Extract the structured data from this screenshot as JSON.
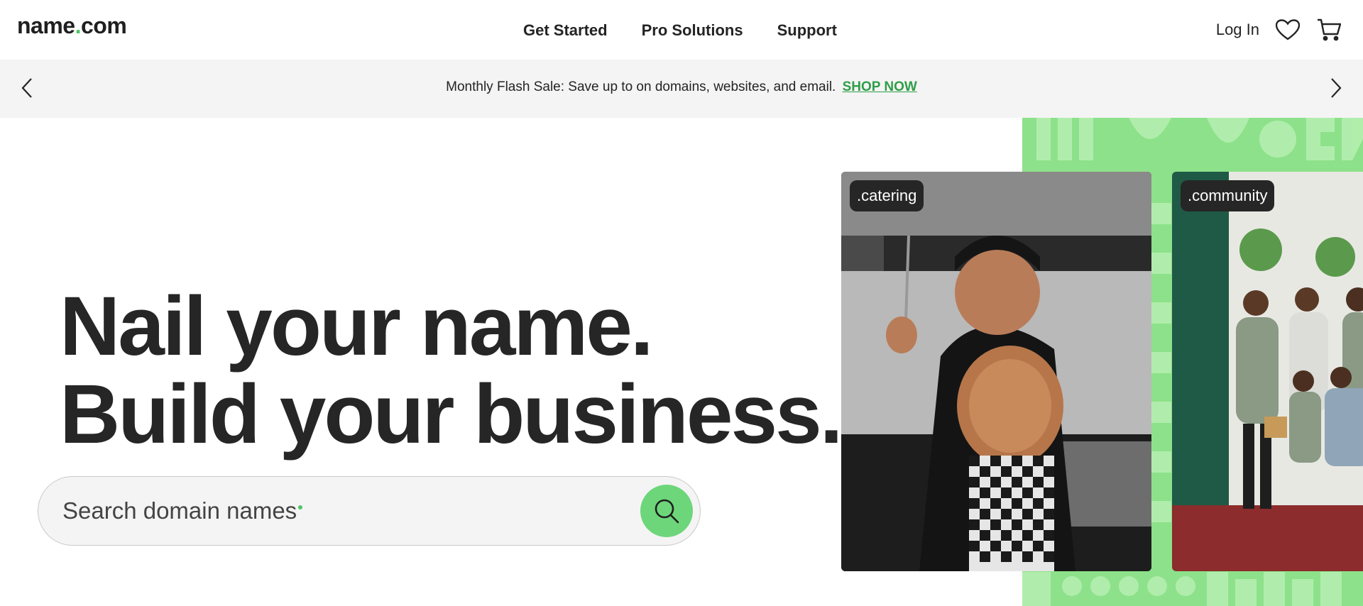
{
  "header": {
    "logo_part1": "name",
    "logo_dot": ".",
    "logo_part2": "com",
    "nav": [
      "Get Started",
      "Pro Solutions",
      "Support"
    ],
    "login": "Log In",
    "icons": [
      "heart-icon",
      "cart-icon"
    ]
  },
  "promo": {
    "text": "Monthly Flash Sale: Save up to on domains, websites, and email.",
    "cta": "SHOP NOW",
    "cta_color": "#2f9e48"
  },
  "hero": {
    "line1": "Nail your name.",
    "line2": "Build your business."
  },
  "search": {
    "placeholder": "Search domain names",
    "button_color": "#6dd67a"
  },
  "cards": [
    {
      "tag": ".catering"
    },
    {
      "tag": ".community"
    }
  ],
  "colors": {
    "accent_green": "#4cc764",
    "pattern_green": "#8de18a",
    "promo_bg": "#f4f4f4"
  }
}
